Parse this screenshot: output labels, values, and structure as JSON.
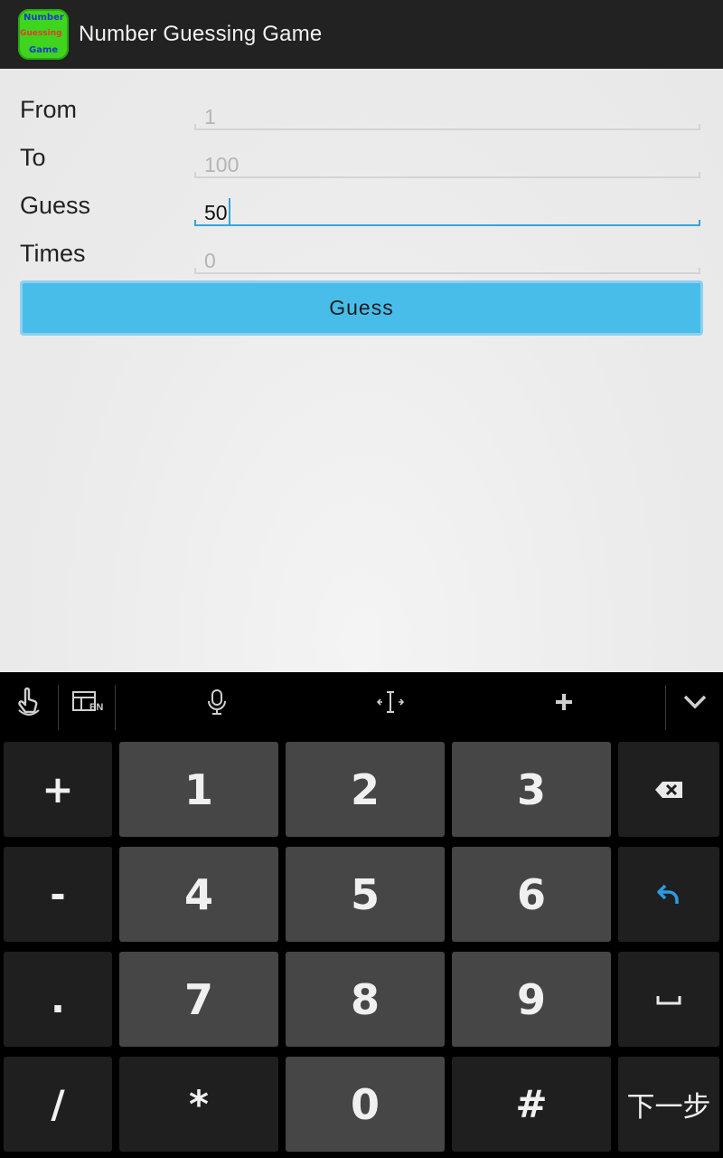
{
  "app": {
    "title": "Number Guessing Game",
    "icon": "number-game-app-icon",
    "icon_text": [
      "Number",
      "Guessing",
      "Game"
    ]
  },
  "form": {
    "from_label": "From",
    "from_value": "1",
    "to_label": "To",
    "to_value": "100",
    "guess_label": "Guess",
    "guess_value": "50",
    "times_label": "Times",
    "times_value": "0",
    "guess_button": "Guess"
  },
  "keyboard": {
    "toolbar": [
      "touch-gesture-icon",
      "keyboard-layout-en-icon",
      "microphone-icon",
      "cursor-move-icon",
      "plus-icon",
      "collapse-keyboard-icon"
    ],
    "layout_badge": "EN",
    "rows": [
      [
        "+",
        "1",
        "2",
        "3",
        "backspace"
      ],
      [
        "-",
        "4",
        "5",
        "6",
        "enter"
      ],
      [
        ".",
        "7",
        "8",
        "9",
        "space"
      ],
      [
        "/",
        "*",
        "0",
        "#",
        "下一步"
      ]
    ],
    "next_label": "下一步"
  },
  "colors": {
    "accent": "#33a6dd",
    "button": "#48bde9",
    "actionbar": "#222222",
    "key_dark": "#1f1f1f",
    "key_light": "#464646"
  }
}
